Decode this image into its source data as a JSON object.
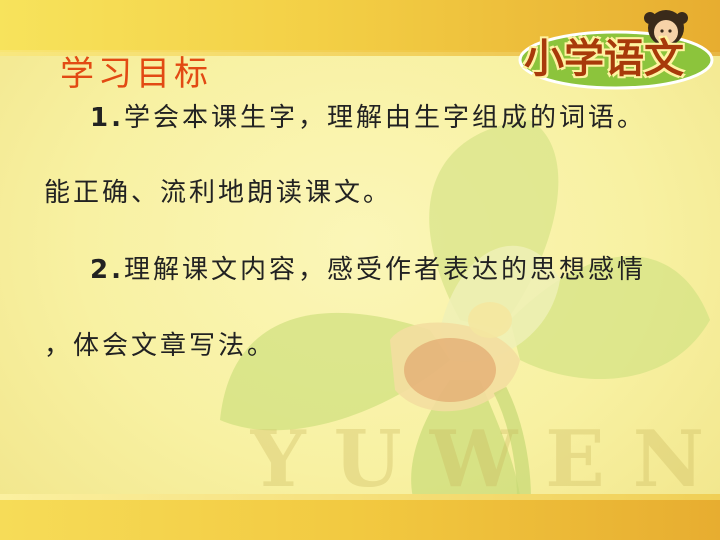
{
  "slide": {
    "heading": "学习目标",
    "logo_text": "小学语文",
    "watermark": "YUWEN",
    "items": [
      {
        "number": "1.",
        "text": "学会本课生字，理解由生字组成的词语。"
      },
      {
        "text": "能正确、流利地朗读课文。"
      },
      {
        "number": "2.",
        "text": "理解课文内容，感受作者表达的思想感情"
      },
      {
        "text": "，体会文章写法。"
      }
    ]
  },
  "colors": {
    "background": "#f8f1a2",
    "band": "#f3cf45",
    "heading": "#e24a13",
    "logo": "#a83a0a"
  }
}
